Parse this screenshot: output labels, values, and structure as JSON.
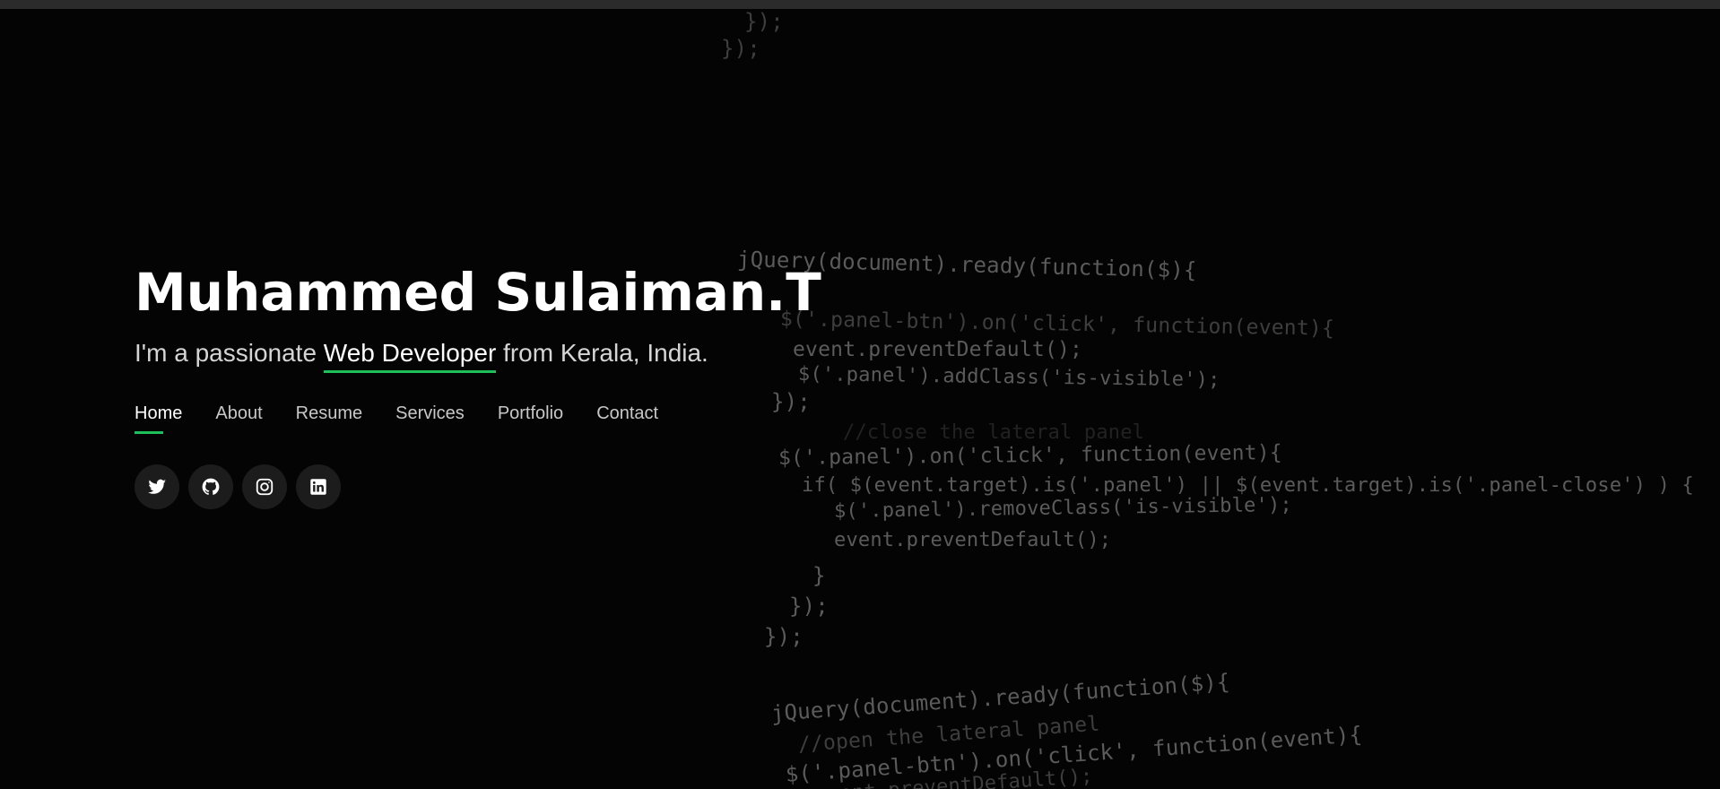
{
  "hero": {
    "name": "Muhammed Sulaiman.T",
    "tagline_prefix": "I'm a passionate ",
    "tagline_role": "Web Developer",
    "tagline_suffix": " from Kerala, India."
  },
  "nav": {
    "items": [
      {
        "label": "Home"
      },
      {
        "label": "About"
      },
      {
        "label": "Resume"
      },
      {
        "label": "Services"
      },
      {
        "label": "Portfolio"
      },
      {
        "label": "Contact"
      }
    ]
  },
  "social": [
    {
      "icon": "twitter-icon"
    },
    {
      "icon": "github-icon"
    },
    {
      "icon": "instagram-icon"
    },
    {
      "icon": "linkedin-icon"
    }
  ],
  "background_code": {
    "lines": [
      "});",
      "});",
      "jQuery(document).ready(function($){",
      "$('.panel-btn').on('click', function(event){",
      "event.preventDefault();",
      "$('.panel').addClass('is-visible');",
      "});",
      "//close the lateral panel",
      "$('.panel').on('click', function(event){",
      "if( $(event.target).is('.panel') || $(event.target).is('.panel-close') ) {",
      "$('.panel').removeClass('is-visible');",
      "event.preventDefault();",
      "}",
      "});",
      "});",
      "jQuery(document).ready(function($){",
      "//open the lateral panel",
      "$('.panel-btn').on('click', function(event){",
      "event.preventDefault();"
    ]
  },
  "colors": {
    "accent": "#1fbf5a",
    "background": "#040404",
    "text_primary": "#ffffff",
    "text_secondary": "#c8c8c8",
    "social_button_bg": "#1c1c1c"
  }
}
